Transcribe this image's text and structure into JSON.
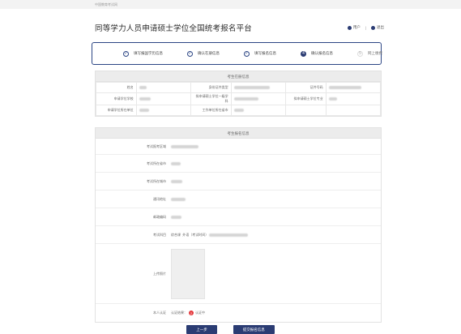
{
  "topbar": {
    "site": "中国教育考试网"
  },
  "header": {
    "title": "同等学力人员申请硕士学位全国统考报名平台",
    "user": "用户",
    "logout": "退出"
  },
  "steps": [
    {
      "label": "填写报国学历信息",
      "state": "done",
      "mark": "✓"
    },
    {
      "label": "确认在册信息",
      "state": "done",
      "mark": "✓"
    },
    {
      "label": "填写报名信息",
      "state": "done",
      "mark": "✓"
    },
    {
      "label": "确认报名信息",
      "state": "active",
      "mark": "4"
    },
    {
      "label": "网上缴费",
      "state": "todo",
      "mark": "5"
    }
  ],
  "reg": {
    "title": "考生在册信息",
    "row1": [
      "姓名",
      "身份证件类型",
      "证件号码"
    ],
    "row2": [
      "申请学位学校",
      "拟申请硕士学位一级学科",
      "拟申请硕士学位专业"
    ],
    "row3": [
      "申请学位所在单位",
      "工作单位所在省市"
    ]
  },
  "app": {
    "title": "考生报名信息",
    "fields": [
      "考试报考区域",
      "考试所在省市",
      "考试所在城市",
      "通讯地址",
      "邮政编码",
      "考试科目",
      "上传照片",
      "本人认证"
    ],
    "subject_note": "综合课",
    "subject_note2": "外语（考试时间）",
    "auth_label": "认证结果：",
    "auth_mark": "2",
    "auth_text": "认证中"
  },
  "buttons": {
    "prev": "上一步",
    "submit": "提交报名信息"
  }
}
